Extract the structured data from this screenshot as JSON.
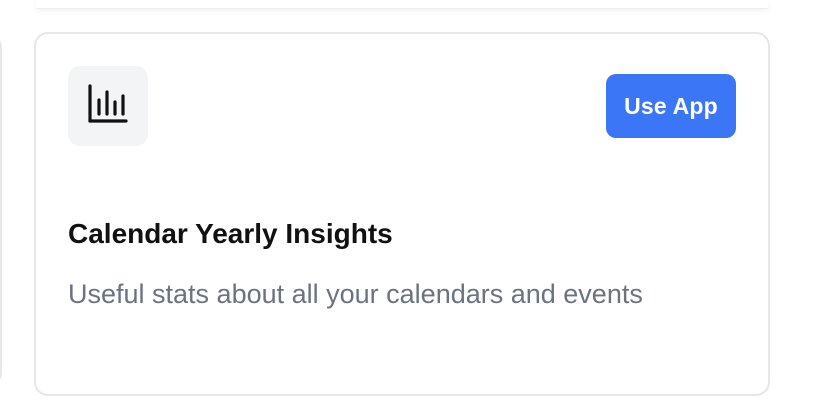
{
  "app_card": {
    "icon": "bar-chart-icon",
    "title": "Calendar Yearly Insights",
    "description": "Useful stats about all your calendars and events",
    "use_button_label": "Use App",
    "accent_color": "#3b76f6"
  }
}
